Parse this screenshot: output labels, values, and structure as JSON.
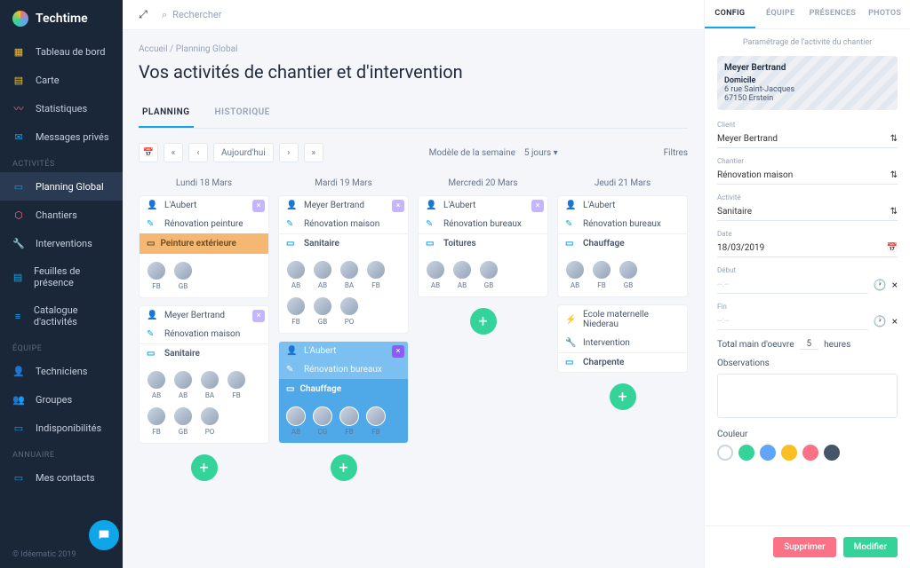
{
  "brand": "Techtime",
  "search_placeholder": "Rechercher",
  "copyright": "© Idéematic 2019",
  "sidebar": {
    "items": [
      {
        "label": "Tableau de bord",
        "icon": "dashboard"
      },
      {
        "label": "Carte",
        "icon": "map"
      },
      {
        "label": "Statistiques",
        "icon": "stats"
      },
      {
        "label": "Messages privés",
        "icon": "chat"
      }
    ],
    "sec_activites": "ACTIVITÉS",
    "activites": [
      {
        "label": "Planning Global",
        "icon": "calendar",
        "active": true
      },
      {
        "label": "Chantiers",
        "icon": "site"
      },
      {
        "label": "Interventions",
        "icon": "wrench"
      },
      {
        "label": "Feuilles de présence",
        "icon": "sheet"
      },
      {
        "label": "Catalogue d'activités",
        "icon": "catalog"
      }
    ],
    "sec_equipe": "ÉQUIPE",
    "equipe": [
      {
        "label": "Techniciens",
        "icon": "user"
      },
      {
        "label": "Groupes",
        "icon": "group"
      },
      {
        "label": "Indisponibilités",
        "icon": "calendar"
      }
    ],
    "sec_annuaire": "ANNUAIRE",
    "annuaire": [
      {
        "label": "Mes contacts",
        "icon": "contact"
      }
    ]
  },
  "breadcrumb": "Accueil  /  Planning Global",
  "page_title": "Vos activités de chantier et d'intervention",
  "tabs": {
    "planning": "PLANNING",
    "historique": "HISTORIQUE"
  },
  "toolbar": {
    "today": "Aujourd'hui",
    "model_label": "Modèle de la semaine",
    "model_value": "5 jours",
    "filters": "Filtres"
  },
  "days": [
    {
      "header": "Lundi 18 Mars",
      "cards": [
        {
          "client": "L'Aubert",
          "project": "Rénovation peinture",
          "task": "Peinture extérieure",
          "task_color": "orange",
          "members": [
            "FB",
            "GB"
          ],
          "closable": true
        },
        {
          "client": "Meyer Bertrand",
          "project": "Rénovation maison",
          "task_header": "Sanitaire",
          "members": [
            "AB",
            "AB",
            "BA",
            "FB",
            "FB",
            "GB",
            "PO"
          ],
          "closable": true
        }
      ]
    },
    {
      "header": "Mardi 19 Mars",
      "cards": [
        {
          "client": "Meyer Bertrand",
          "project": "Rénovation maison",
          "task_header": "Sanitaire",
          "members": [
            "AB",
            "AB",
            "BA",
            "FB",
            "FB",
            "GB",
            "PO"
          ],
          "closable": true
        },
        {
          "client": "L'Aubert",
          "project": "Rénovation bureaux",
          "task": "Chauffage",
          "task_color": "blue",
          "members": [
            "AB",
            "CG",
            "FB",
            "FB"
          ],
          "closable": true,
          "blue": true
        }
      ]
    },
    {
      "header": "Mercredi 20 Mars",
      "cards": [
        {
          "client": "L'Aubert",
          "project": "Rénovation bureaux",
          "task_header": "Toitures",
          "members": [
            "AB",
            "AB",
            "GB"
          ],
          "closable": true
        }
      ]
    },
    {
      "header": "Jeudi 21 Mars",
      "cards": [
        {
          "client": "L'Aubert",
          "project": "Rénovation bureaux",
          "task_header": "Chauffage",
          "members": [
            "AB",
            "FB",
            "GB"
          ]
        },
        {
          "client": "Ecole maternelle Niederau",
          "project": "Intervention",
          "task_header": "Charpente",
          "members": [],
          "intervention": true
        }
      ]
    }
  ],
  "panel": {
    "tabs": {
      "config": "CONFIG",
      "equipe": "ÉQUIPE",
      "presences": "PRÉSENCES",
      "photos": "PHOTOS"
    },
    "subtitle": "Paramétrage de l'activité du chantier",
    "person": "Meyer Bertrand",
    "addr_label": "Domicile",
    "addr1": "6 rue Saint-Jacques",
    "addr2": "67150 Erstein",
    "fields": {
      "client_label": "Client",
      "client_value": "Meyer Bertrand",
      "chantier_label": "Chantier",
      "chantier_value": "Rénovation maison",
      "activite_label": "Activité",
      "activite_value": "Sanitaire",
      "date_label": "Date",
      "date_value": "18/03/2019",
      "debut_label": "Début",
      "debut_value": "--:--",
      "fin_label": "Fin",
      "fin_value": "--:--",
      "total_label": "Total main d'oeuvre",
      "total_value": "5",
      "total_unit": "heures",
      "obs_label": "Observations",
      "color_label": "Couleur"
    },
    "colors": [
      "#ffffff",
      "#34d399",
      "#60a5fa",
      "#fbbf24",
      "#fb7185",
      "#475569"
    ],
    "btn_delete": "Supprimer",
    "btn_edit": "Modifier"
  }
}
